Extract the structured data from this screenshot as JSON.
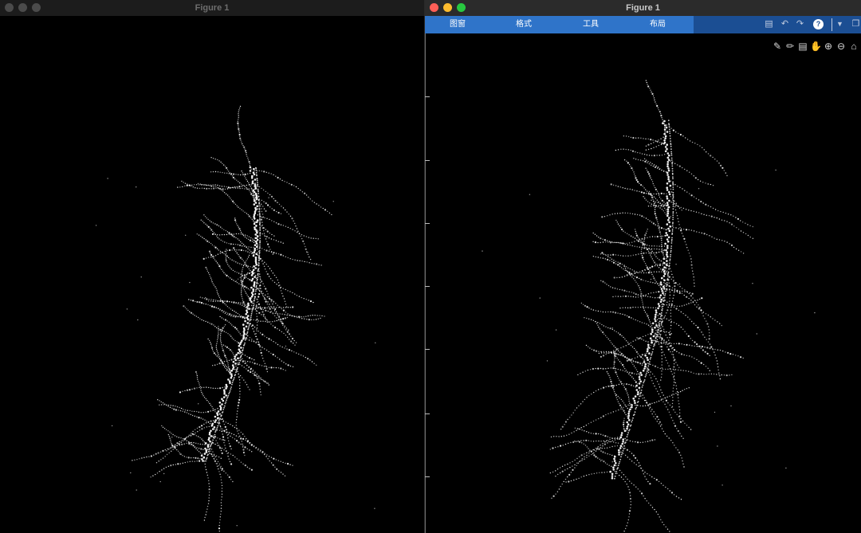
{
  "windows": {
    "left": {
      "title": "Figure 1"
    },
    "right": {
      "title": "Figure 1"
    }
  },
  "menu": {
    "tabs": [
      "图窗",
      "格式",
      "工具",
      "布局"
    ]
  },
  "toolstrip": {
    "icons": [
      "save-icon",
      "undo-icon",
      "redo-icon",
      "help-icon",
      "toggle-icon",
      "undock-icon"
    ]
  },
  "axes_toolbar": {
    "icons": [
      "brush-icon",
      "datatip-icon",
      "export-icon",
      "pan-icon",
      "zoom-in-icon",
      "zoom-out-icon",
      "home-icon"
    ]
  },
  "colors": {
    "background": "#000000",
    "points": "#ffffff",
    "menu": "#2f74c9",
    "toolstrip": "#1b4e93"
  }
}
